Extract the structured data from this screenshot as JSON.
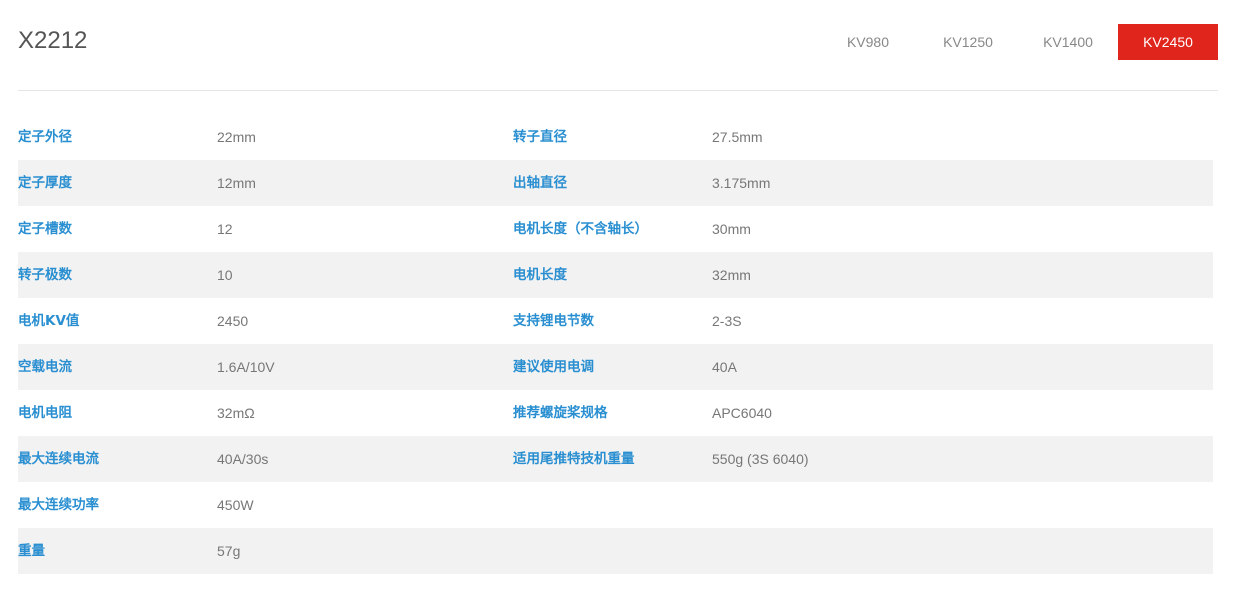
{
  "product": {
    "title": "X2212"
  },
  "tabs": [
    {
      "label": "KV980"
    },
    {
      "label": "KV1250"
    },
    {
      "label": "KV1400"
    },
    {
      "label": "KV2450",
      "active": true
    }
  ],
  "colors": {
    "accent": "#e0251c",
    "label": "#2a8fd1",
    "value": "#777777",
    "stripe": "#f2f2f2"
  },
  "specs": [
    {
      "label1": "定子外径",
      "value1": "22mm",
      "label2": "转子直径",
      "value2": "27.5mm"
    },
    {
      "label1": "定子厚度",
      "value1": "12mm",
      "label2": "出轴直径",
      "value2": "3.175mm"
    },
    {
      "label1": "定子槽数",
      "value1": "12",
      "label2": "电机长度（不含轴长）",
      "value2": "30mm"
    },
    {
      "label1": "转子极数",
      "value1": "10",
      "label2": "电机长度",
      "value2": "32mm"
    },
    {
      "label1": "电机KV值",
      "value1": "2450",
      "label2": "支持锂电节数",
      "value2": "2-3S"
    },
    {
      "label1": "空载电流",
      "value1": "1.6A/10V",
      "label2": "建议使用电调",
      "value2": "40A"
    },
    {
      "label1": "电机电阻",
      "value1": "32mΩ",
      "label2": "推荐螺旋桨规格",
      "value2": "APC6040"
    },
    {
      "label1": "最大连续电流",
      "value1": "40A/30s",
      "label2": "适用尾推特技机重量",
      "value2": "550g (3S 6040)"
    },
    {
      "label1": "最大连续功率",
      "value1": "450W",
      "label2": "",
      "value2": ""
    },
    {
      "label1": "重量",
      "value1": "57g",
      "label2": "",
      "value2": ""
    }
  ]
}
